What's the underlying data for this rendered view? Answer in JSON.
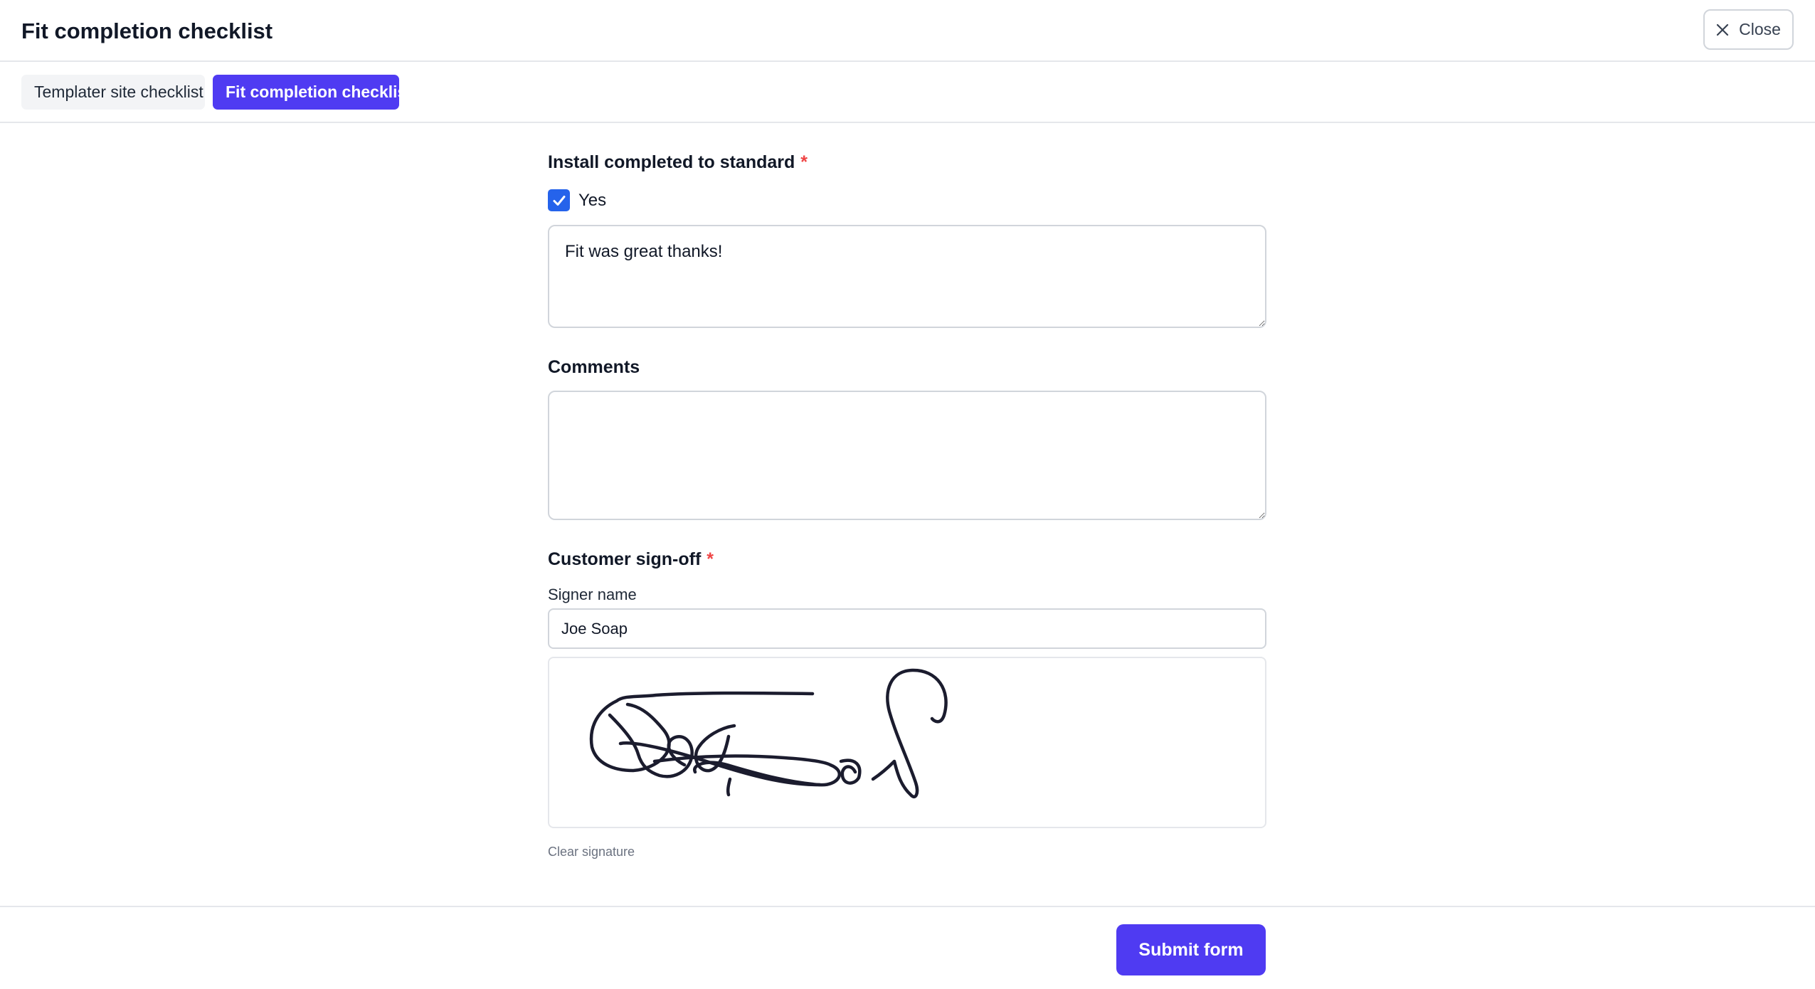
{
  "header": {
    "title": "Fit completion checklist",
    "close_label": "Close",
    "close_icon": "x-icon"
  },
  "tabs": [
    {
      "label": "Templater site checklist",
      "active": false
    },
    {
      "label": "Fit completion checklist",
      "active": true
    }
  ],
  "form": {
    "install": {
      "label": "Install completed to standard",
      "required_marker": "*",
      "checkbox_label": "Yes",
      "checked": true,
      "note": "Fit was great thanks!"
    },
    "comments": {
      "label": "Comments",
      "value": ""
    },
    "signoff": {
      "label": "Customer sign-off",
      "required_marker": "*",
      "signer_label": "Signer name",
      "signer_value": "Joe Soap",
      "clear_label": "Clear signature"
    }
  },
  "footer": {
    "submit_label": "Submit form"
  },
  "colors": {
    "accent": "#4f3bf2",
    "checkbox": "#2563eb",
    "required": "#ef4444",
    "signature_ink": "#1b1c2e"
  }
}
